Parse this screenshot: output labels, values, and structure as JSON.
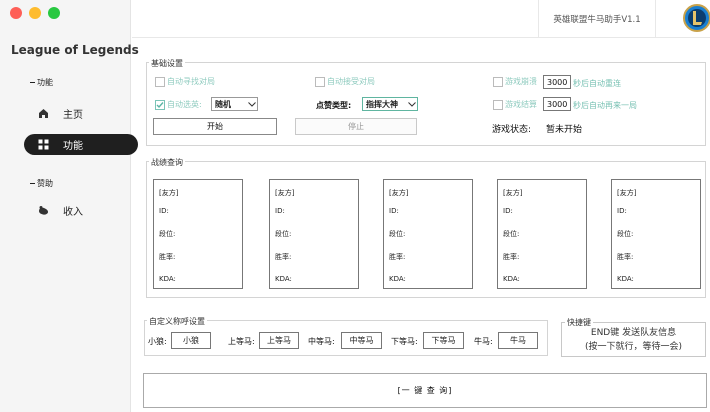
{
  "app": {
    "name": "League of Legends",
    "window_title": "英雄联盟牛马助手V1.1"
  },
  "sidebar": {
    "section_function": "功能",
    "section_sponsor": "赞助",
    "items": [
      {
        "label": "主页",
        "icon": "home-icon",
        "active": false
      },
      {
        "label": "功能",
        "icon": "grid-icon",
        "active": true
      },
      {
        "label": "收入",
        "icon": "income-icon",
        "active": false
      }
    ]
  },
  "basic": {
    "title": "基础设置",
    "auto_find_match": "自动寻找对局",
    "auto_accept_match": "自动接受对局",
    "game_crash": "游戏崩溃",
    "crash_seconds": "3000",
    "crash_suffix": "秒后自动重连",
    "auto_pick": "自动选英:",
    "pick_value": "随机",
    "like_type_label": "点赞类型:",
    "like_type_value": "指挥大神",
    "game_end": "游戏结算",
    "end_seconds": "3000",
    "end_suffix": "秒后自动再来一局",
    "start_button": "开始",
    "stop_button": "停止",
    "status_label": "游戏状态:",
    "status_value": "暂未开始"
  },
  "record": {
    "title": "战绩查询",
    "cards": [
      {
        "team": "[友方]",
        "id": "ID:",
        "rank": "段位:",
        "winrate": "胜率:",
        "kda": "KDA:"
      },
      {
        "team": "[友方]",
        "id": "ID:",
        "rank": "段位:",
        "winrate": "胜率:",
        "kda": "KDA:"
      },
      {
        "team": "[友方]",
        "id": "ID:",
        "rank": "段位:",
        "winrate": "胜率:",
        "kda": "KDA:"
      },
      {
        "team": "[友方]",
        "id": "ID:",
        "rank": "段位:",
        "winrate": "胜率:",
        "kda": "KDA:"
      },
      {
        "team": "[友方]",
        "id": "ID:",
        "rank": "段位:",
        "winrate": "胜率:",
        "kda": "KDA:"
      }
    ]
  },
  "nicknames": {
    "title": "自定义称呼设置",
    "fields": [
      {
        "label": "小狼:",
        "value": "小狼"
      },
      {
        "label": "上等马:",
        "value": "上等马"
      },
      {
        "label": "中等马:",
        "value": "中等马"
      },
      {
        "label": "下等马:",
        "value": "下等马"
      },
      {
        "label": "牛马:",
        "value": "牛马"
      }
    ]
  },
  "hotkey": {
    "title": "快捷键",
    "line1": "END键 发送队友信息",
    "line2": "(按一下就行，等待一会)"
  },
  "query_button": "[一 键 查 询]"
}
